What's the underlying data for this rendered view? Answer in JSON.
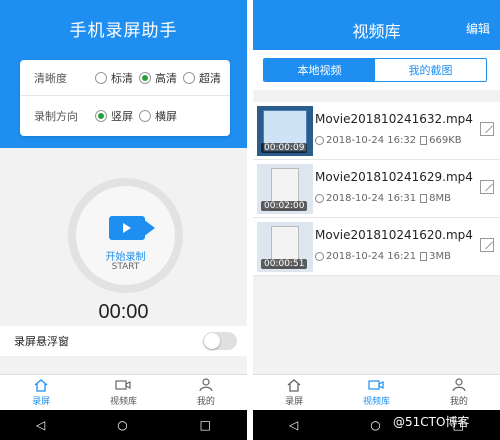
{
  "left": {
    "title": "手机录屏助手",
    "quality": {
      "label": "清晰度",
      "options": [
        "标清",
        "高清",
        "超清"
      ],
      "selected": "高清"
    },
    "orientation": {
      "label": "录制方向",
      "options": [
        "竖屏",
        "横屏"
      ],
      "selected": "竖屏"
    },
    "record": {
      "label_cn": "开始录制",
      "label_en": "START"
    },
    "timer": "00:00",
    "floating": {
      "label": "录屏悬浮窗",
      "enabled": false
    }
  },
  "right": {
    "title": "视频库",
    "edit": "编辑",
    "tabs": [
      "本地视频",
      "我的截图"
    ],
    "videos": [
      {
        "name": "Movie201810241632.mp4",
        "duration": "00:00:09",
        "datetime": "2018-10-24 16:32",
        "size": "669KB"
      },
      {
        "name": "Movie201810241629.mp4",
        "duration": "00:02:00",
        "datetime": "2018-10-24 16:31",
        "size": "8MB"
      },
      {
        "name": "Movie201810241620.mp4",
        "duration": "00:00:51",
        "datetime": "2018-10-24 16:21",
        "size": "3MB"
      }
    ]
  },
  "tabbar": [
    "录屏",
    "视频库",
    "我的"
  ],
  "watermark": "@51CTO博客",
  "colors": {
    "accent": "#1e8ff0",
    "radio_on": "#25a03d"
  }
}
